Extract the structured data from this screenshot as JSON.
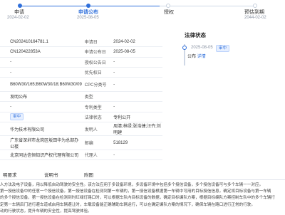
{
  "timeline": [
    {
      "label": "申请",
      "date": "2024-02-02",
      "state": "done"
    },
    {
      "label": "申请公布",
      "date": "2025-08-05",
      "state": "current"
    },
    {
      "label": "授权",
      "date": "",
      "state": "pending"
    },
    {
      "label": "预估到期",
      "date": "2044-02-02",
      "state": "pending"
    }
  ],
  "table": {
    "rows": [
      {
        "k1": "",
        "v1": "CN202410164781.1",
        "k2": "申请日",
        "v2": "2024-02-02"
      },
      {
        "k1": "",
        "v1": "CN120422853A",
        "k2": "申请公布日",
        "v2": "2025-08-05"
      },
      {
        "k1": "",
        "v1": "-",
        "k2": "授权公告日",
        "v2": "-"
      },
      {
        "k1": "",
        "v1": "-",
        "k2": "优先权日",
        "v2": "-"
      },
      {
        "k1": "",
        "v1": "B60W30/165;B60W30/18;B60W30/09",
        "k2": "CPC分类号",
        "v2": "-",
        "tall": true
      },
      {
        "k1": "",
        "v1": "发明公布",
        "k2": "类型",
        "v2": "",
        "link1": true
      },
      {
        "k1": "",
        "v1": "-",
        "k2": "专利类型",
        "v2": "-"
      },
      {
        "k1": "",
        "v1": "审中",
        "k2": "法律状态",
        "v2": "专利公开",
        "tag1": true,
        "link2": true
      },
      {
        "k1": "",
        "v1": "华为技术有限公司",
        "k2": "发明人",
        "v2": "周清;林绿;张浩捷;汪齐;刘明建",
        "link1": true
      },
      {
        "k1": "",
        "v1": "广东省深圳市龙岗区坂田华为总部办公楼",
        "k2": "邮编",
        "v2": "518129",
        "tall": true
      },
      {
        "k1": "",
        "v1": "北京同达信恒知识产权代理有限公司",
        "k2": "代理人",
        "v2": "-",
        "link1": true
      }
    ]
  },
  "right_panel": {
    "title": "法律状态",
    "event_date": "2025-08-05",
    "event_tag": "审中",
    "event_text": "公布",
    "event_link": "详情"
  },
  "tabs": [
    "明要求",
    "说明书",
    "附图"
  ],
  "abstract_lines": [
    "人方法及电子设备，用以降低自动驾驶的安全性。该方法应用于多设备环境，多设备环境中包括多个授信设备，多个授信设备可与多个车辆一一对应。",
    "第一授信设备中的任意一个授信设备。第一授信设备在检测到第一车辆的，第一授信设备根据第一车辆中可用的目标授信信息，确定将目标设备与第一车辆",
    "的多个授信设备，第一授信设备在检测到时红绿灯路口时，可以根据车队内目标设备的数据，确定目标编队方案，根据目标编队方案控制车队中的多个车辆行",
    "定第一车辆后门进行避车道或启用车辆避让时，车载设备能正确辅助车辆运行，可以在确定编队方案的情况下，确保车辆在路口进行正常的行驶。",
    "动的行驶状态，提升车辆的安全性，提高驾驶体验。"
  ]
}
